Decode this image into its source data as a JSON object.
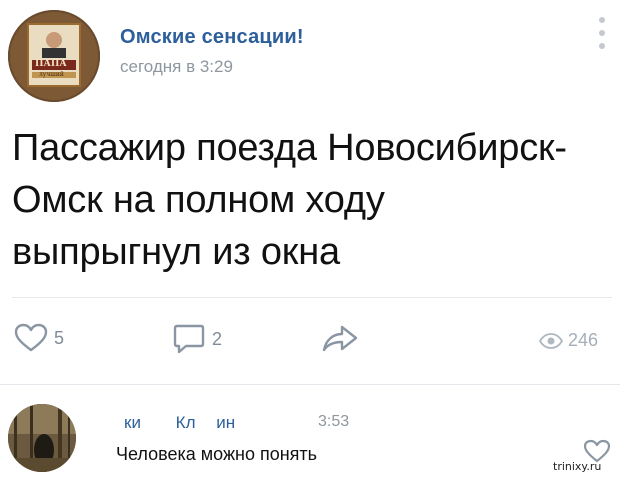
{
  "post": {
    "group_name": "Омские сенсации!",
    "time": "сегодня в 3:29",
    "avatar_label_top": "ПАПА",
    "avatar_label_bottom": "лучший",
    "text_line1": "Пассажир поезда Новосибирск-",
    "text_line2": "Омск на полном ходу",
    "text_line3": "выпрыгнул из окна"
  },
  "actions": {
    "likes": "5",
    "comments": "2",
    "views": "246"
  },
  "comment": {
    "author_part1": "ки",
    "author_part2": "Кл",
    "author_part3": "ин",
    "time": "3:53",
    "text": "Человека можно понять"
  },
  "watermark": "trinixy.ru",
  "colors": {
    "link": "#2d5f9b",
    "meta": "#8e979f",
    "icon": "#818c99"
  },
  "icons": [
    "heart-icon",
    "comment-icon",
    "share-icon",
    "eye-icon",
    "more-icon"
  ]
}
